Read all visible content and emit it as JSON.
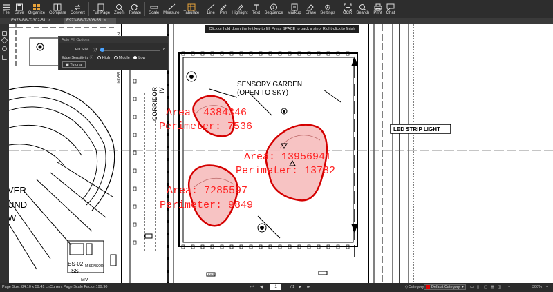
{
  "toolbar": {
    "items": [
      {
        "label": "File",
        "icon": "menu-icon"
      },
      {
        "label": "Save",
        "icon": "save-icon"
      },
      {
        "label": "Organize",
        "icon": "organize-icon"
      },
      {
        "label": "Compare",
        "icon": "compare-icon"
      },
      {
        "label": "Convert",
        "icon": "convert-icon"
      },
      {
        "label": "Full Page",
        "icon": "full-page-icon"
      },
      {
        "label": "Zoom",
        "icon": "zoom-icon"
      },
      {
        "label": "Rotate",
        "icon": "rotate-icon"
      },
      {
        "label": "Scale",
        "icon": "scale-icon"
      },
      {
        "label": "Measure",
        "icon": "measure-icon"
      },
      {
        "label": "Tabulate",
        "icon": "tabulate-icon"
      },
      {
        "label": "Line",
        "icon": "line-icon"
      },
      {
        "label": "Pen",
        "icon": "pen-icon"
      },
      {
        "label": "Highlight",
        "icon": "highlight-icon"
      },
      {
        "label": "Text",
        "icon": "text-icon"
      },
      {
        "label": "Sequence",
        "icon": "sequence-icon"
      },
      {
        "label": "Markup",
        "icon": "markup-icon"
      },
      {
        "label": "Erase",
        "icon": "erase-icon"
      },
      {
        "label": "Settings",
        "icon": "gear-icon"
      },
      {
        "label": "OCR",
        "icon": "ocr-icon"
      },
      {
        "label": "Search",
        "icon": "search-icon"
      },
      {
        "label": "Print",
        "icon": "print-icon"
      },
      {
        "label": "Chat",
        "icon": "chat-icon"
      }
    ]
  },
  "tabs": [
    {
      "label": "E973-BB-T-302-51"
    },
    {
      "label": "E973-BB-T-306-55"
    }
  ],
  "hint": "Click or hold down the left key to fill. Press SPACE to back a step. Right-click to finish",
  "auto_fill": {
    "title": "Auto Fill Options",
    "fill_size_label": "Fill Size",
    "fill_size_min": "1",
    "fill_size_max": "8",
    "fill_size_value": 0.05,
    "edge_label": "Edge Sensitivity",
    "edge_options": [
      "High",
      "Middle",
      "Low"
    ],
    "edge_selected": "Low",
    "tutorial_label": "Tutorial"
  },
  "drawing": {
    "garden_title_1": "SENSORY GARDEN",
    "garden_title_2": "(OPEN TO SKY)",
    "corridor_1": "CORRIDOR",
    "corridor_2": "IV",
    "led_label": "LED STRIP LIGHT",
    "left_text_1": "VER",
    "left_text_2": "UND",
    "left_text_3": "W",
    "tag_1": "ES-02",
    "tag_2": "SS",
    "tag_3": "MV",
    "sensor": "M SENSOR",
    "exit": "EXIT",
    "vertical_text": "UNDER LIFE SAFETY PLAN",
    "measurements": [
      {
        "area": "Area: 4384346",
        "perimeter": "Perimeter: 7536"
      },
      {
        "area": "Area: 13956941",
        "perimeter": "Perimeter: 13782"
      },
      {
        "area": "Area: 7285597",
        "perimeter": "Perimeter: 9849"
      }
    ]
  },
  "status": {
    "page_size": "Page Size: 84.10 x 59.41 cm",
    "scale_factor": "Current Page Scale Factor:199.90",
    "current_page": "1",
    "total_pages": "/ 1",
    "category_label": "Category",
    "category_value": "Default Category",
    "zoom": "300%"
  },
  "colors": {
    "accent": "#4aa3ff",
    "fill_red": "#e00000",
    "toolbar_bg": "#2d2d2d"
  }
}
